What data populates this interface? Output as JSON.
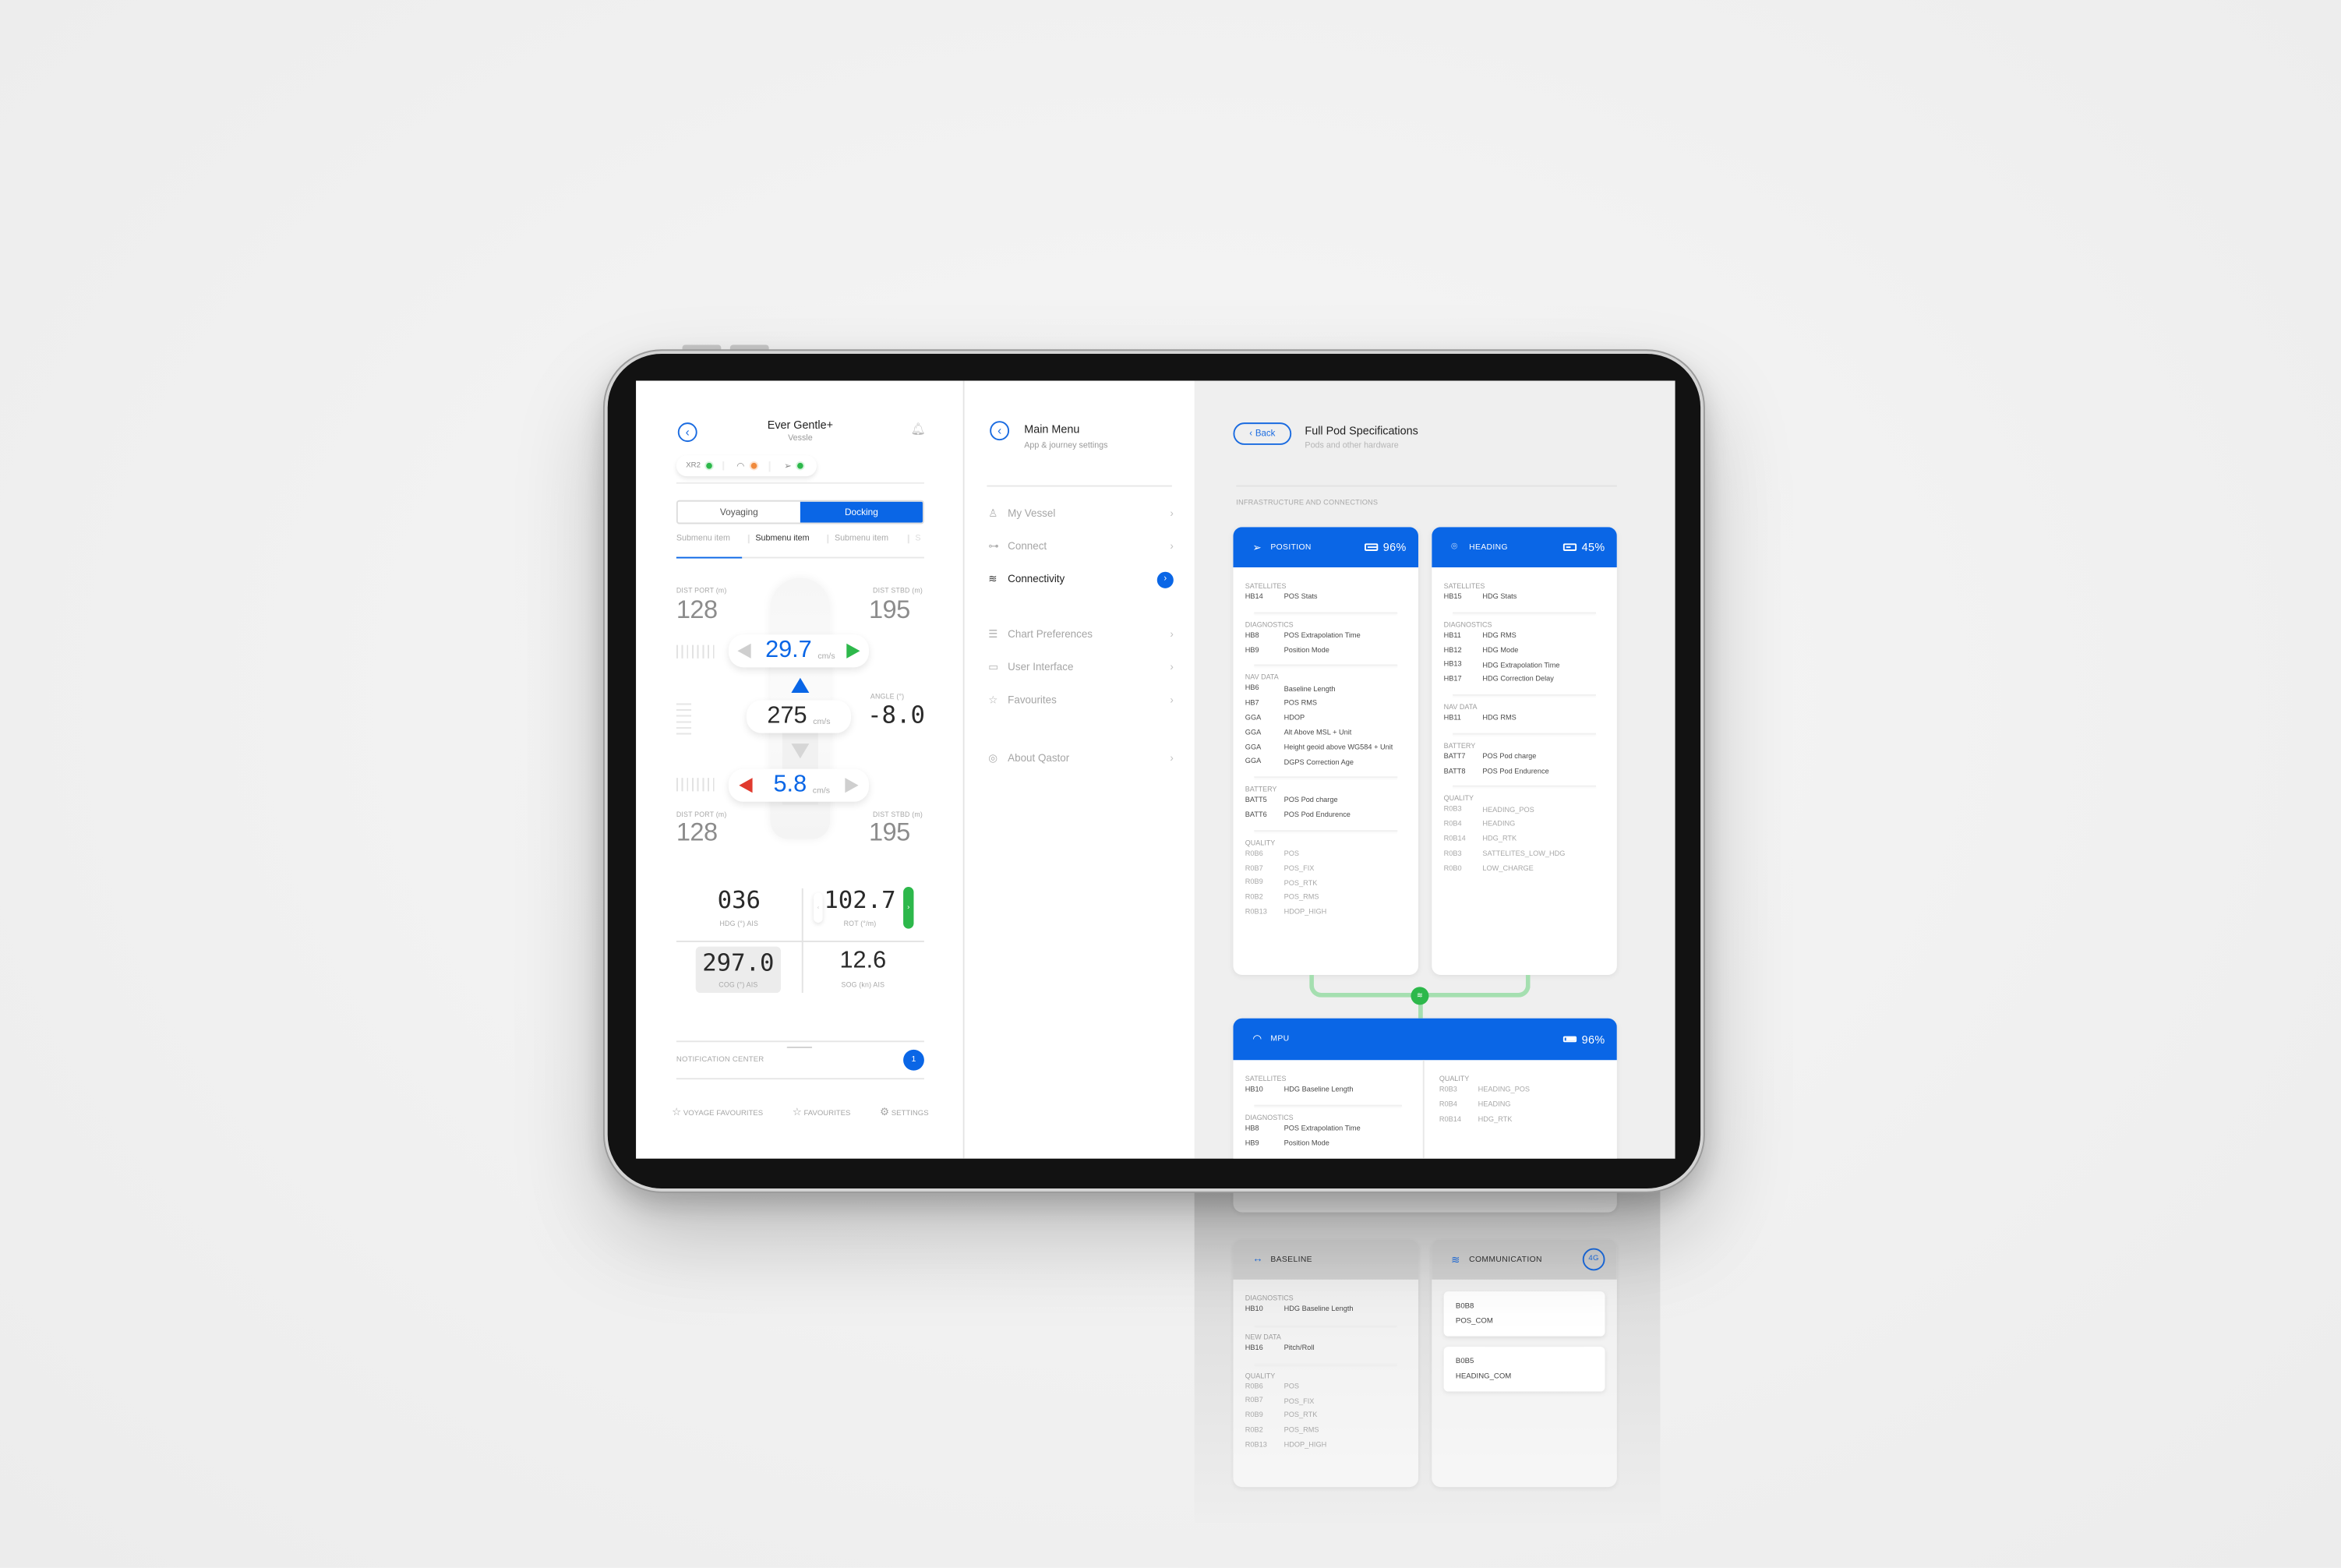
{
  "vessel_panel": {
    "title": "Ever Gentle+",
    "subtitle": "Vessle",
    "status": [
      {
        "label": "XR2",
        "icon": "",
        "dot_color": "#2db84b"
      },
      {
        "label": "",
        "icon": "gauge-icon",
        "dot_color": "#f08a3c"
      },
      {
        "label": "",
        "icon": "navigation-icon",
        "dot_color": "#2db84b"
      }
    ],
    "mode_tabs": [
      "Voyaging",
      "Docking"
    ],
    "active_mode": "Docking",
    "submenu": [
      "Submenu item",
      "Submenu item",
      "Submenu item",
      "S"
    ],
    "docking": {
      "top_port_label": "DIST PORT (m)",
      "top_port_value": "128",
      "top_stbd_label": "DIST STBD (m)",
      "top_stbd_value": "195",
      "bow_speed": "29.7",
      "bow_unit": "cm/s",
      "center_speed": "275",
      "center_unit": "cm/s",
      "angle_label": "ANGLE (°)",
      "angle_value": "-8.0",
      "stern_speed": "5.8",
      "stern_unit": "cm/s",
      "bottom_port_label": "DIST PORT (m)",
      "bottom_port_value": "128",
      "bottom_stbd_label": "DIST STBD (m)",
      "bottom_stbd_value": "195"
    },
    "stats": {
      "hdg_value": "036",
      "hdg_label": "HDG (°) AIS",
      "rot_value": "102.7",
      "rot_label": "ROT (°/m)",
      "cog_value": "297.0",
      "cog_label": "COG (°) AIS",
      "sog_value": "12.6",
      "sog_label": "SOG (kn) AIS"
    },
    "notification": {
      "label": "NOTIFICATION CENTER",
      "count": "1"
    },
    "bottom_nav": [
      {
        "label": "VOYAGE FAVOURITES",
        "icon": "voyage-favourites-icon"
      },
      {
        "label": "FAVOURITES",
        "icon": "star-icon"
      },
      {
        "label": "SETTINGS",
        "icon": "gear-icon"
      }
    ]
  },
  "main_menu": {
    "title": "Main Menu",
    "subtitle": "App & journey settings",
    "items": [
      {
        "label": "My Vessel",
        "icon": "vessel-icon",
        "active": false
      },
      {
        "label": "Connect",
        "icon": "connect-icon",
        "active": false
      },
      {
        "label": "Connectivity",
        "icon": "wifi-icon",
        "active": true
      },
      {
        "label": "Chart Preferences",
        "icon": "sliders-icon",
        "active": false
      },
      {
        "label": "User Interface",
        "icon": "window-cursor-icon",
        "active": false
      },
      {
        "label": "Favourites",
        "icon": "star-icon",
        "active": false
      },
      {
        "label": "About Qastor",
        "icon": "qastor-logo-icon",
        "active": false
      }
    ]
  },
  "pod_specs": {
    "back_label": "Back",
    "title": "Full Pod Specifications",
    "subtitle": "Pods and other hardware",
    "section_label": "INFRASTRUCTURE AND CONNECTIONS",
    "accent_color": "#0a66e6",
    "link_color": "#2db84b",
    "position": {
      "title": "POSITION",
      "battery": "96%",
      "battery_level": 0.96,
      "sections": [
        {
          "title": "SATELLITES",
          "rows": [
            [
              "HB14",
              "POS Stats"
            ]
          ]
        },
        {
          "title": "DIAGNOSTICS",
          "rows": [
            [
              "HB8",
              "POS Extrapolation Time"
            ],
            [
              "HB9",
              "Position Mode"
            ]
          ]
        },
        {
          "title": "NAV DATA",
          "rows": [
            [
              "HB6",
              "Baseline Length"
            ],
            [
              "HB7",
              "POS RMS"
            ],
            [
              "GGA",
              "HDOP"
            ],
            [
              "GGA",
              "Alt Above MSL + Unit"
            ],
            [
              "GGA",
              "Height geoid above WG584 + Unit"
            ],
            [
              "GGA",
              "DGPS Correction Age"
            ]
          ]
        },
        {
          "title": "BATTERY",
          "rows": [
            [
              "BATT5",
              "POS Pod charge"
            ],
            [
              "BATT6",
              "POS Pod Endurence"
            ]
          ]
        },
        {
          "title": "QUALITY",
          "muted": true,
          "rows": [
            [
              "R0B6",
              "POS"
            ],
            [
              "R0B7",
              "POS_FIX"
            ],
            [
              "R0B9",
              "POS_RTK"
            ],
            [
              "R0B2",
              "POS_RMS"
            ],
            [
              "R0B13",
              "HDOP_HIGH"
            ]
          ]
        }
      ]
    },
    "heading": {
      "title": "HEADING",
      "battery": "45%",
      "battery_level": 0.45,
      "sections": [
        {
          "title": "SATELLITES",
          "rows": [
            [
              "HB15",
              "HDG Stats"
            ]
          ]
        },
        {
          "title": "DIAGNOSTICS",
          "rows": [
            [
              "HB11",
              "HDG RMS"
            ],
            [
              "HB12",
              "HDG Mode"
            ],
            [
              "HB13",
              "HDG Extrapolation Time"
            ],
            [
              "HB17",
              "HDG Correction Delay"
            ]
          ]
        },
        {
          "title": "NAV DATA",
          "rows": [
            [
              "HB11",
              "HDG RMS"
            ]
          ]
        },
        {
          "title": "BATTERY",
          "rows": [
            [
              "BATT7",
              "POS Pod charge"
            ],
            [
              "BATT8",
              "POS Pod Endurence"
            ]
          ]
        },
        {
          "title": "QUALITY",
          "muted": true,
          "rows": [
            [
              "R0B3",
              "HEADING_POS"
            ],
            [
              "R0B4",
              "HEADING"
            ],
            [
              "R0B14",
              "HDG_RTK"
            ],
            [
              "R0B3",
              "SATTELITES_LOW_HDG"
            ],
            [
              "R0B0",
              "LOW_CHARGE"
            ]
          ]
        }
      ]
    },
    "mpu": {
      "title": "MPU",
      "battery": "96%",
      "battery_level": 0.96,
      "left_sections": [
        {
          "title": "SATELLITES",
          "rows": [
            [
              "HB10",
              "HDG Baseline Length"
            ]
          ]
        },
        {
          "title": "DIAGNOSTICS",
          "rows": [
            [
              "HB8",
              "POS Extrapolation Time"
            ],
            [
              "HB9",
              "Position Mode"
            ]
          ]
        }
      ],
      "right_sections": [
        {
          "title": "QUALITY",
          "muted": true,
          "rows": [
            [
              "R0B3",
              "HEADING_POS"
            ],
            [
              "R0B4",
              "HEADING"
            ],
            [
              "R0B14",
              "HDG_RTK"
            ]
          ]
        }
      ]
    },
    "baseline": {
      "title": "BASELINE",
      "sections": [
        {
          "title": "DIAGNOSTICS",
          "rows": [
            [
              "HB10",
              "HDG Baseline Length"
            ]
          ]
        },
        {
          "title": "NEW DATA",
          "rows": [
            [
              "HB16",
              "Pitch/Roll"
            ]
          ]
        },
        {
          "title": "QUALITY",
          "muted": true,
          "rows": [
            [
              "R0B6",
              "POS"
            ],
            [
              "R0B7",
              "POS_FIX"
            ],
            [
              "R0B9",
              "POS_RTK"
            ],
            [
              "R0B2",
              "POS_RMS"
            ],
            [
              "R0B13",
              "HDOP_HIGH"
            ]
          ]
        }
      ]
    },
    "communication": {
      "title": "COMMUNICATION",
      "badge": "4G",
      "items": [
        [
          "B0B8",
          "POS_COM"
        ],
        [
          "B0B5",
          "HEADING_COM"
        ]
      ]
    }
  }
}
